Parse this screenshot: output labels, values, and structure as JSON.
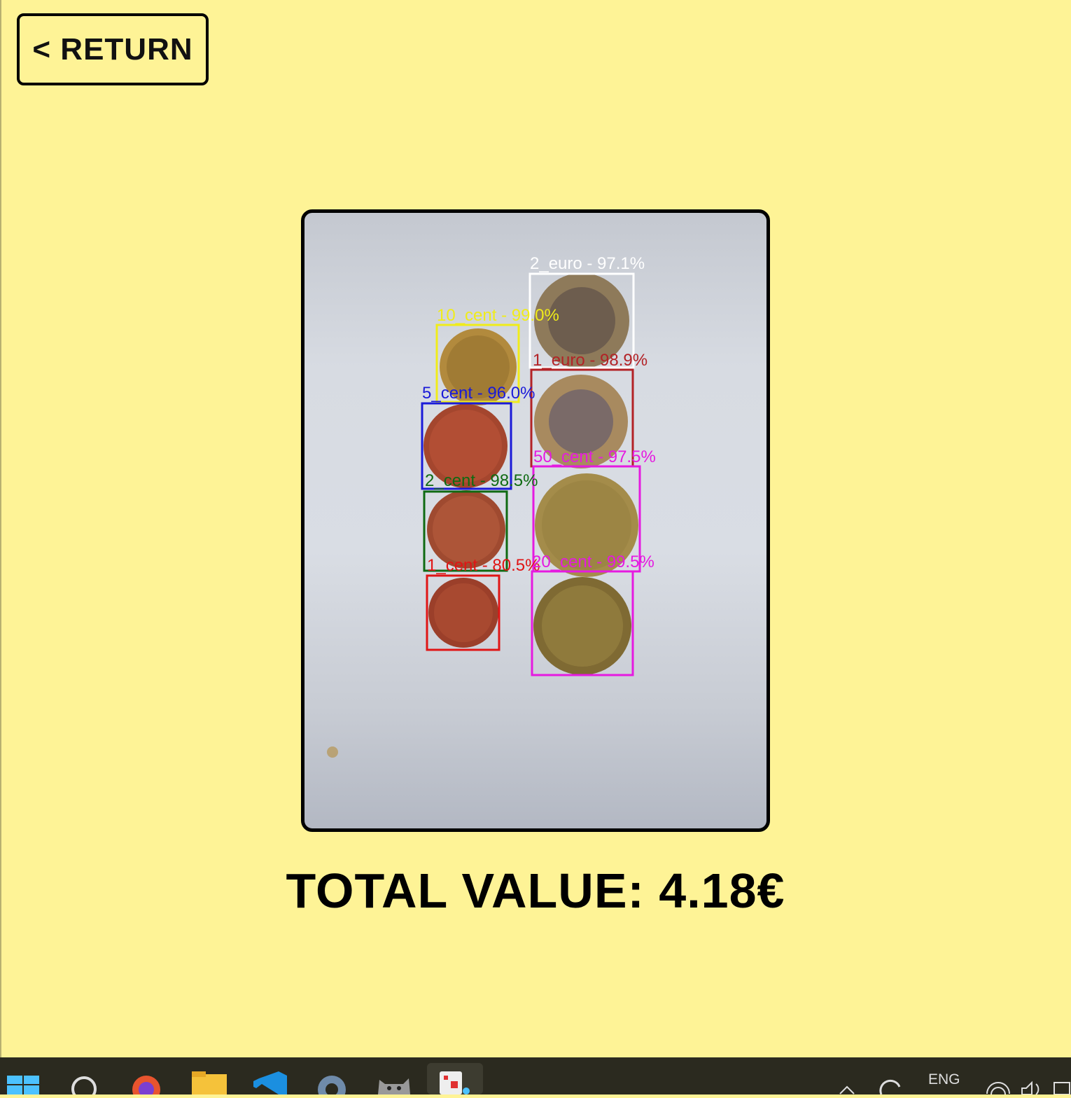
{
  "return_button": {
    "label": "< RETURN"
  },
  "detections": [
    {
      "label": "2_euro - 97.1%",
      "color": "#ffffff"
    },
    {
      "label": "10_cent - 99.0%",
      "color": "#f0ec1a"
    },
    {
      "label": "1_euro - 98.9%",
      "color": "#b32226"
    },
    {
      "label": "5_cent - 96.0%",
      "color": "#1a1ad8"
    },
    {
      "label": "50_cent - 97.5%",
      "color": "#e51ae0"
    },
    {
      "label": "2_cent - 98.5%",
      "color": "#0f6a12"
    },
    {
      "label": "1_cent - 80.5%",
      "color": "#e01515"
    },
    {
      "label": "20_cent - 99.5%",
      "color": "#e51ae0"
    }
  ],
  "total": {
    "text": "TOTAL VALUE: 4.18€"
  },
  "taskbar": {
    "icons": [
      "windows-start-icon",
      "search-icon",
      "firefox-icon",
      "file-explorer-icon",
      "vscode-icon",
      "settings-icon",
      "cat-app-icon",
      "active-app-icon"
    ],
    "tray": {
      "language": "ENG"
    }
  }
}
